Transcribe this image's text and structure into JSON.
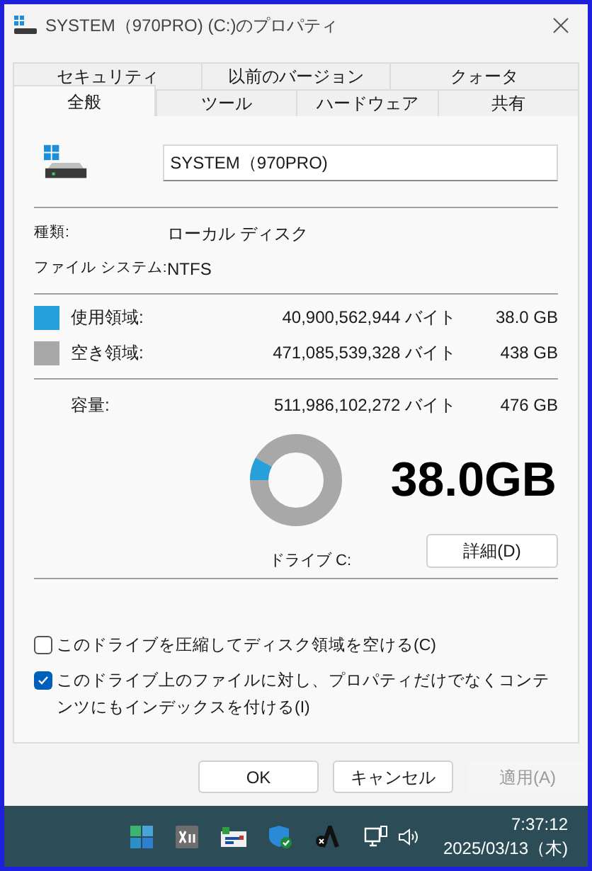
{
  "window": {
    "title": "SYSTEM（970PRO) (C:)のプロパティ"
  },
  "tabs": [
    [
      {
        "label": "セキュリティ",
        "selected": false
      },
      {
        "label": "以前のバージョン",
        "selected": false
      },
      {
        "label": "クォータ",
        "selected": false
      }
    ],
    [
      {
        "label": "全般",
        "selected": true
      },
      {
        "label": "ツール",
        "selected": false
      },
      {
        "label": "ハードウェア",
        "selected": false
      },
      {
        "label": "共有",
        "selected": false
      }
    ]
  ],
  "drive_name": "SYSTEM（970PRO)",
  "info": [
    {
      "label": "種類:",
      "value": "ローカル ディスク"
    },
    {
      "label": "ファイル システム:",
      "value": "NTFS"
    }
  ],
  "space": [
    {
      "label": "使用領域:",
      "bytes": "40,900,562,944 バイト",
      "size": "38.0 GB",
      "color": "#26a0da"
    },
    {
      "label": "空き領域:",
      "bytes": "471,085,539,328 バイト",
      "size": "438 GB",
      "color": "#a8a8a8"
    }
  ],
  "capacity": {
    "label": "容量:",
    "bytes": "511,986,102,272 バイト",
    "size": "476 GB"
  },
  "usage": {
    "level": 0.08,
    "big_label": "38.0GB",
    "drive_label": "ドライブ C:",
    "details_button": "詳細(D)"
  },
  "options": [
    {
      "label": "このドライブを圧縮してディスク領域を空ける(C)",
      "checked": false
    },
    {
      "label": "このドライブ上のファイルに対し、プロパティだけでなくコンテンツにもインデックスを付ける(I)",
      "checked": true
    }
  ],
  "buttons": [
    {
      "label": "OK",
      "disabled": false
    },
    {
      "label": "キャンセル",
      "disabled": false
    },
    {
      "label": "適用(A)",
      "disabled": true
    }
  ],
  "taskbar": {
    "time": "7:37:12",
    "date": "2025/03/13（木)"
  }
}
